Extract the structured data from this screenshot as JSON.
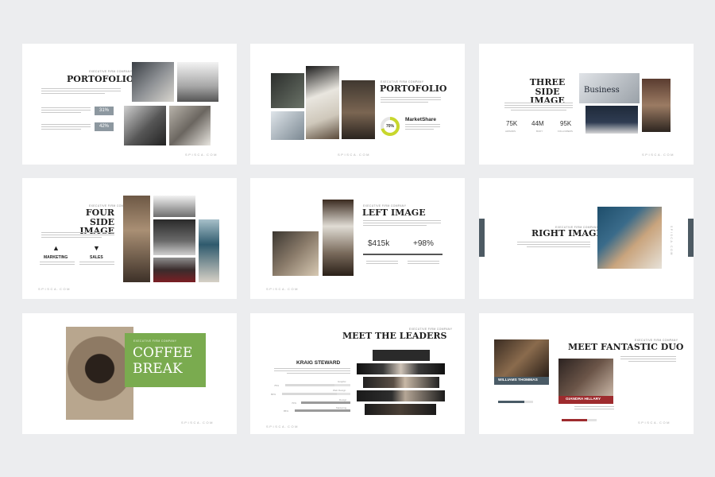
{
  "footer": "SPISCA.COM",
  "tagline": "EXECUTIVE FIRM COMPANY",
  "s1": {
    "title": "PORTOFOLIO",
    "badges": [
      "31%",
      "42%"
    ]
  },
  "s2": {
    "title": "PORTOFOLIO",
    "donut": "70%",
    "label": "MarketShare"
  },
  "s3": {
    "title": "THREE SIDE IMAGE",
    "stats": [
      "75K",
      "44M",
      "95K"
    ],
    "stat_labels": [
      "AWARDS",
      "BUDY",
      "FOLLOWERS"
    ],
    "banner": "Business"
  },
  "s4": {
    "title": "FOUR SIDE IMAGE",
    "items": [
      "MARKETING",
      "SALES"
    ]
  },
  "s5": {
    "title": "LEFT IMAGE",
    "stats": [
      "$415k",
      "+98%"
    ]
  },
  "s6": {
    "title": "RIGHT IMAGE"
  },
  "s7": {
    "title": "COFFEE BREAK",
    "accent": "#7aab4f"
  },
  "s8": {
    "title": "MEET THE LEADERS",
    "name": "KRAIG STEWARD",
    "skills": [
      "Graphic",
      "Web Design",
      "Design",
      "Marketing"
    ],
    "pcts": [
      "75%",
      "80%",
      "70%",
      "85%"
    ]
  },
  "s9": {
    "title": "MEET FANTASTIC DUO",
    "names": [
      "WILLIAMS THOMMAS",
      "GIANDRA HILLARY"
    ],
    "accent1": "#4a5b66",
    "accent2": "#9e2b2e"
  }
}
